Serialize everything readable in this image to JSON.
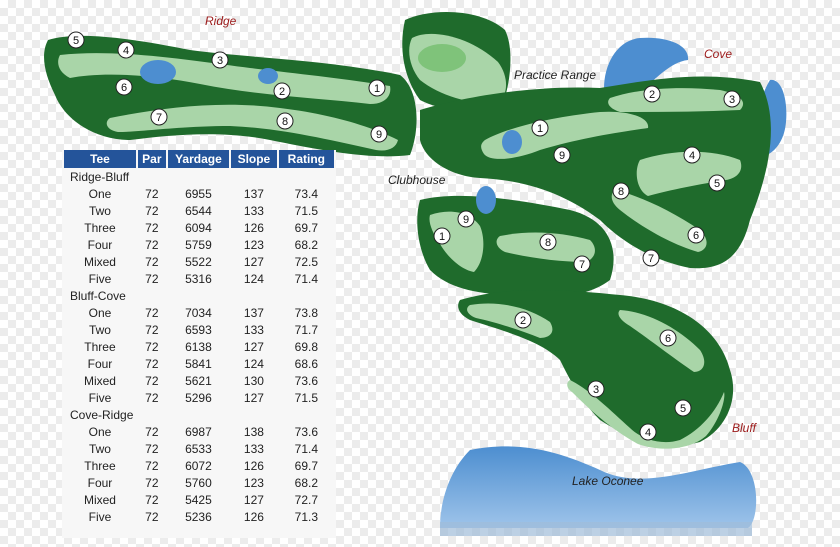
{
  "map": {
    "labels": {
      "ridge": "Ridge",
      "cove": "Cove",
      "bluff": "Bluff",
      "practice_range": "Practice Range",
      "clubhouse": "Clubhouse",
      "lake": "Lake Oconee"
    },
    "ridge_holes": [
      "5",
      "4",
      "3",
      "2",
      "1",
      "6",
      "7",
      "8",
      "9"
    ],
    "cove_holes": [
      "2",
      "3",
      "1",
      "9",
      "4",
      "5",
      "8",
      "6",
      "7"
    ],
    "middle_holes": [
      "9",
      "1",
      "8",
      "7"
    ],
    "bluff_holes": [
      "2",
      "6",
      "3",
      "5",
      "4"
    ]
  },
  "scorecard": {
    "headers": [
      "Tee",
      "Par",
      "Yardage",
      "Slope",
      "Rating"
    ],
    "groups": [
      {
        "name": "Ridge-Bluff",
        "rows": [
          [
            "One",
            "72",
            "6955",
            "137",
            "73.4"
          ],
          [
            "Two",
            "72",
            "6544",
            "133",
            "71.5"
          ],
          [
            "Three",
            "72",
            "6094",
            "126",
            "69.7"
          ],
          [
            "Four",
            "72",
            "5759",
            "123",
            "68.2"
          ],
          [
            "Mixed",
            "72",
            "5522",
            "127",
            "72.5"
          ],
          [
            "Five",
            "72",
            "5316",
            "124",
            "71.4"
          ]
        ]
      },
      {
        "name": "Bluff-Cove",
        "rows": [
          [
            "One",
            "72",
            "7034",
            "137",
            "73.8"
          ],
          [
            "Two",
            "72",
            "6593",
            "133",
            "71.7"
          ],
          [
            "Three",
            "72",
            "6138",
            "127",
            "69.8"
          ],
          [
            "Four",
            "72",
            "5841",
            "124",
            "68.6"
          ],
          [
            "Mixed",
            "72",
            "5621",
            "130",
            "73.6"
          ],
          [
            "Five",
            "72",
            "5296",
            "127",
            "71.5"
          ]
        ]
      },
      {
        "name": "Cove-Ridge",
        "rows": [
          [
            "One",
            "72",
            "6987",
            "138",
            "73.6"
          ],
          [
            "Two",
            "72",
            "6533",
            "133",
            "71.4"
          ],
          [
            "Three",
            "72",
            "6072",
            "126",
            "69.7"
          ],
          [
            "Four",
            "72",
            "5760",
            "123",
            "68.2"
          ],
          [
            "Mixed",
            "72",
            "5425",
            "127",
            "72.7"
          ],
          [
            "Five",
            "72",
            "5236",
            "126",
            "71.3"
          ]
        ]
      }
    ]
  }
}
